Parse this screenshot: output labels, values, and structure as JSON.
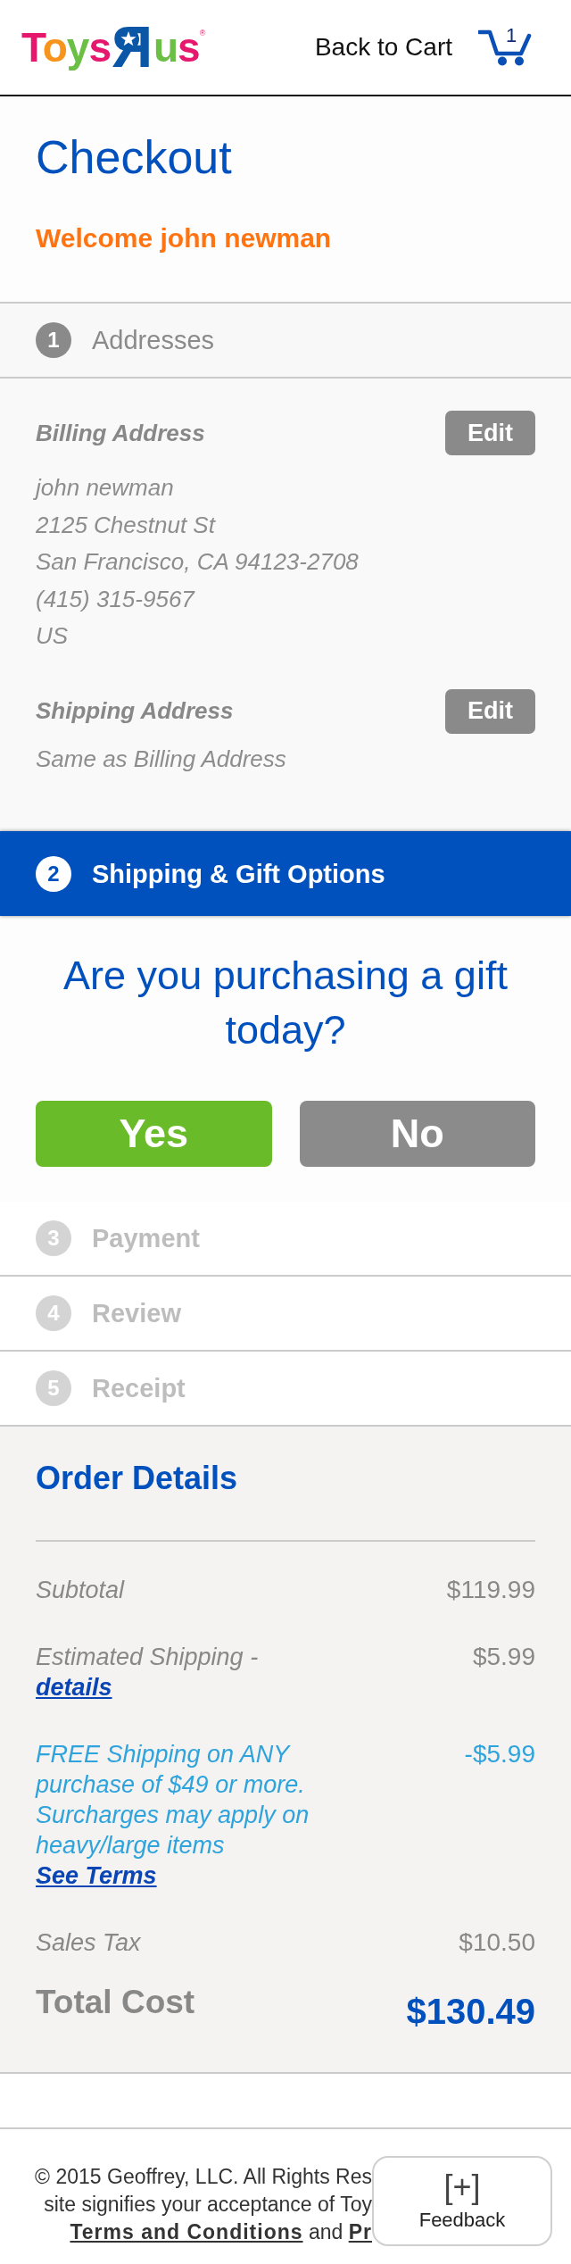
{
  "header": {
    "logo": [
      {
        "kind": "word",
        "text": "Toys"
      },
      {
        "kind": "reversed",
        "text": "Я"
      },
      {
        "kind": "word",
        "text": "us"
      },
      {
        "kind": "mark",
        "text": "®"
      }
    ],
    "back_link": "Back to Cart",
    "cart_count": "1"
  },
  "title": "Checkout",
  "welcome": "Welcome john newman",
  "steps": [
    {
      "number": "1",
      "label": "Addresses",
      "selected": false,
      "disabled": false,
      "addresses": [
        {
          "heading": "Billing Address",
          "edit": "Edit",
          "lines": [
            "john newman",
            "2125 Chestnut St",
            "San Francisco, CA 94123-2708",
            "(415) 315-9567",
            "US"
          ]
        },
        {
          "heading": "Shipping Address",
          "edit": "Edit",
          "lines": [
            "Same as Billing Address"
          ]
        }
      ]
    },
    {
      "number": "2",
      "label": "Shipping & Gift Options",
      "selected": true,
      "disabled": false,
      "gift_prompt": {
        "question": "Are you purchasing a gift today?",
        "options": [
          {
            "label": "Yes",
            "color": "#69bb29"
          },
          {
            "label": "No",
            "color": "#8b8b8b"
          }
        ]
      }
    },
    {
      "number": "3",
      "label": "Payment",
      "selected": false,
      "disabled": true
    },
    {
      "number": "4",
      "label": "Review",
      "selected": false,
      "disabled": true
    },
    {
      "number": "5",
      "label": "Receipt",
      "selected": false,
      "disabled": true
    }
  ],
  "order_details": {
    "title": "Order Details",
    "rows": [
      {
        "kind": "line",
        "label": "Subtotal",
        "value": "$119.99"
      },
      {
        "kind": "line",
        "label": "Estimated Shipping -",
        "link": "details",
        "value": "$5.99"
      },
      {
        "kind": "promo",
        "text": "FREE Shipping on ANY purchase of $49 or more. Surcharges may apply on heavy/large items",
        "link": "See Terms",
        "value": "-$5.99"
      },
      {
        "kind": "line",
        "label": "Sales Tax",
        "value": "$10.50"
      },
      {
        "kind": "total",
        "label": "Total Cost",
        "value": "$130.49"
      }
    ]
  },
  "footer": {
    "lines": [
      "© 2015 Geoffrey, LLC. All Rights Res",
      "site signifies your acceptance of Toy"
    ],
    "last_line": [
      {
        "kind": "link",
        "text": "Terms and Conditions"
      },
      {
        "kind": "text",
        "text": "and"
      },
      {
        "kind": "link",
        "text": "Pr"
      }
    ]
  },
  "feedback": {
    "icon_text": "[+]",
    "label": "Feedback"
  }
}
